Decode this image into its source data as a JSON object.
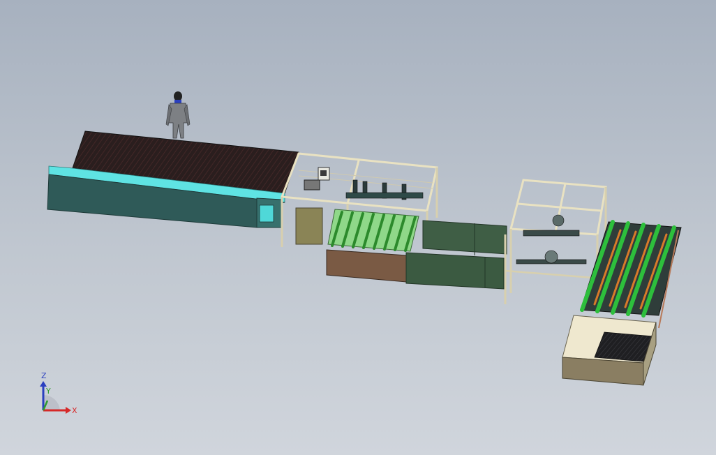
{
  "viewport": {
    "background_top": "#a7b1bf",
    "background_bottom": "#d0d5dc"
  },
  "colors": {
    "conveyor_teal": "#2f5a58",
    "conveyor_cyan": "#5fe3e3",
    "belt_dark": "#2a1e1e",
    "frame_beige": "#e9e2c2",
    "cabinet_green": "#3f5e45",
    "roller_green": "#2dbf3c",
    "roller_orange": "#d87a2a",
    "base_brown": "#7a5a44",
    "platform_cream": "#efe8cf",
    "human_gray": "#7d8084"
  },
  "triad": {
    "z_label": "Z",
    "y_label": "Y",
    "x_label": "X",
    "x_color": "#d62828",
    "y_color": "#2f9a2f",
    "z_color": "#2a3fbf"
  }
}
